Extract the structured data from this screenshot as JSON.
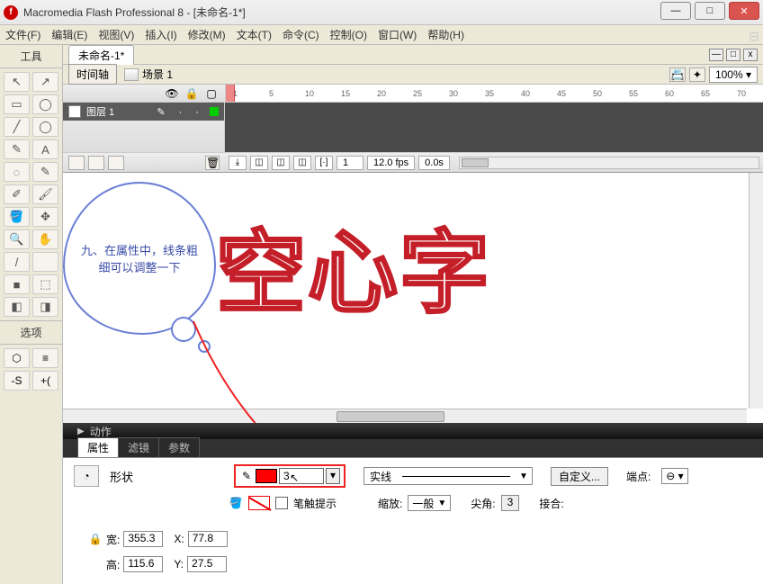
{
  "window": {
    "title": "Macromedia Flash Professional 8 - [未命名-1*]"
  },
  "menubar": [
    "文件(F)",
    "编辑(E)",
    "视图(V)",
    "插入(I)",
    "修改(M)",
    "文本(T)",
    "命令(C)",
    "控制(O)",
    "窗口(W)",
    "帮助(H)"
  ],
  "tools": {
    "header": "工具",
    "options_header": "选项",
    "icons": [
      "↖",
      "↗",
      "▭",
      "◯",
      "╱",
      "◯",
      "✎",
      "A",
      "◌",
      "✎",
      "✐",
      "🖌",
      "🪣",
      "✥",
      "🔍",
      "✋",
      "/",
      "",
      "■",
      "⬚",
      "◧",
      "◨"
    ],
    "option_icons": [
      "⬡",
      "≡",
      "-S",
      "+("
    ]
  },
  "doc_tab": "未命名-1*",
  "timeline": {
    "button": "时间轴",
    "scene": "场景 1",
    "zoom": "100%",
    "layer_name": "图层 1",
    "ruler_ticks": [
      "1",
      "5",
      "10",
      "15",
      "20",
      "25",
      "30",
      "35",
      "40",
      "45",
      "50",
      "55",
      "60",
      "65",
      "70"
    ],
    "status": {
      "frame": "1",
      "fps": "12.0 fps",
      "time": "0.0s"
    }
  },
  "callout": "九、在属性中，线条粗细可以调整一下",
  "canvas_text": "空心字",
  "actions_panel": "动作",
  "properties": {
    "tabs": [
      "属性",
      "滤镜",
      "参数"
    ],
    "shape_label": "形状",
    "stroke_width": "3",
    "line_style": "实线",
    "custom_btn": "自定义...",
    "cap_label": "端点:",
    "stroke_hint": "笔触提示",
    "scale_label": "缩放:",
    "scale_value": "一般",
    "miter_label": "尖角:",
    "miter_value": "3",
    "join_label": "接合:",
    "w_label": "宽:",
    "w_value": "355.3",
    "x_label": "X:",
    "x_value": "77.8",
    "h_label": "高:",
    "h_value": "115.6",
    "y_label": "Y:",
    "y_value": "27.5"
  }
}
